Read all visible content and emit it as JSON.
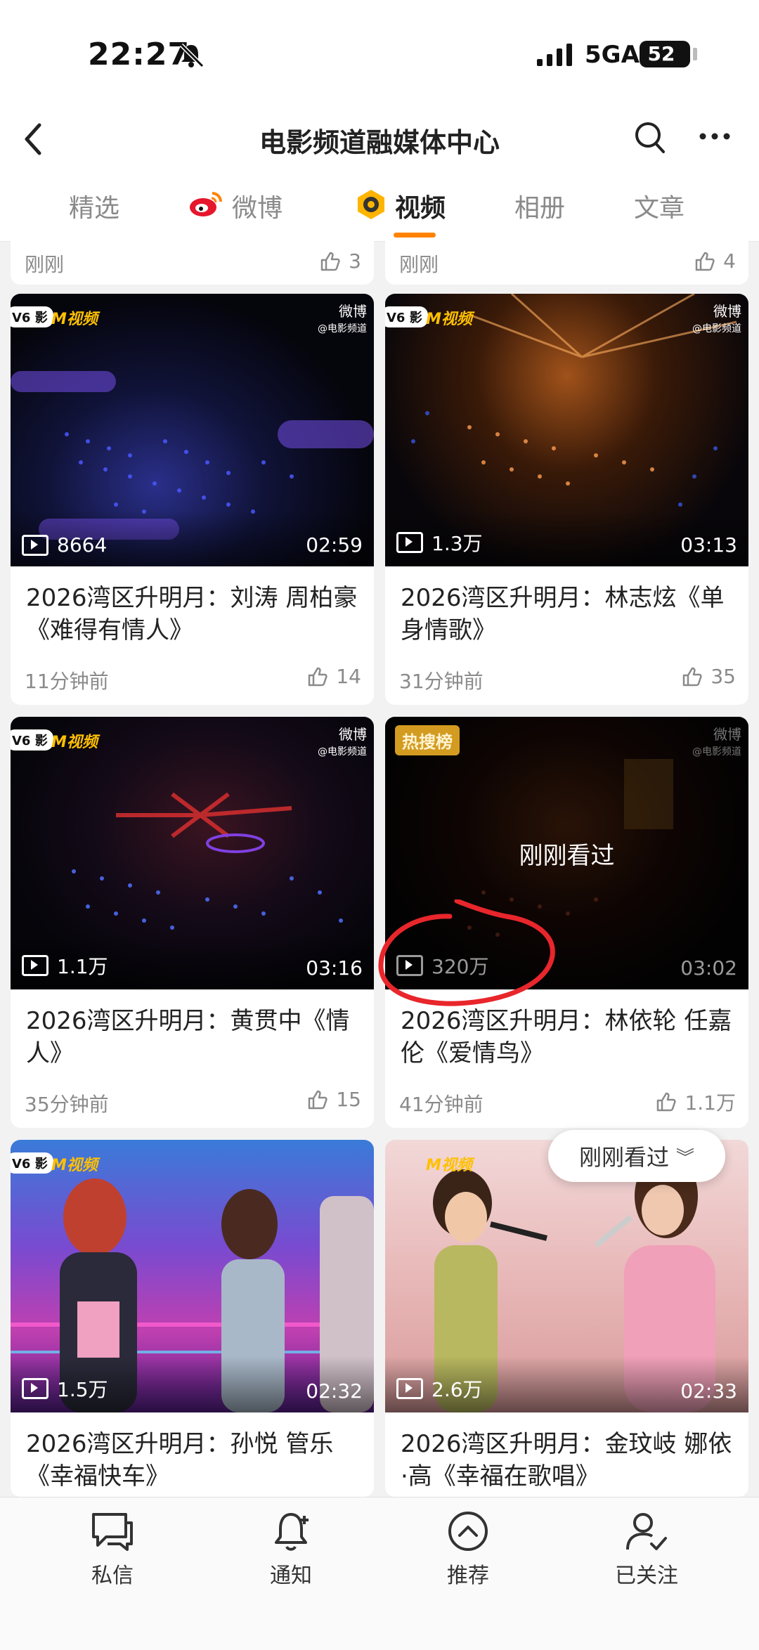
{
  "status_bar": {
    "time": "22:27",
    "network": "5GA",
    "battery": "52"
  },
  "header": {
    "title": "电影频道融媒体中心"
  },
  "tabs": [
    {
      "label": "精选",
      "active": false
    },
    {
      "label": "微博",
      "active": false
    },
    {
      "label": "视频",
      "active": true
    },
    {
      "label": "相册",
      "active": false
    },
    {
      "label": "文章",
      "active": false
    }
  ],
  "partial_cards": [
    {
      "time": "刚刚",
      "likes": "3"
    },
    {
      "time": "刚刚",
      "likes": "4"
    }
  ],
  "cards": [
    {
      "views": "8664",
      "duration": "02:59",
      "title": "2026湾区升明月：刘涛 周柏豪《难得有情人》",
      "time": "11分钟前",
      "likes": "14"
    },
    {
      "views": "1.3万",
      "duration": "03:13",
      "title": "2026湾区升明月：林志炫《单身情歌》",
      "time": "31分钟前",
      "likes": "35"
    },
    {
      "views": "1.1万",
      "duration": "03:16",
      "title": "2026湾区升明月：黄贯中《情人》",
      "time": "35分钟前",
      "likes": "15"
    },
    {
      "views": "320万",
      "duration": "03:02",
      "title": "2026湾区升明月：林依轮 任嘉伦《爱情鸟》",
      "time": "41分钟前",
      "likes": "1.1万",
      "badge": "热搜榜",
      "overlay_text": "刚刚看过"
    },
    {
      "views": "1.5万",
      "duration": "02:32",
      "title": "2026湾区升明月：孙悦 管乐《幸福快车》"
    },
    {
      "views": "2.6万",
      "duration": "02:33",
      "title": "2026湾区升明月：金玟岐 娜依·高《幸福在歌唱》"
    }
  ],
  "thumb_logos": {
    "cctv": "V6 影",
    "m": "M视频",
    "weibo": "微博",
    "weibo_sub": "@电影频道"
  },
  "float_button": {
    "label": "刚刚看过"
  },
  "bottom_nav": [
    {
      "label": "私信",
      "icon": "message-icon"
    },
    {
      "label": "通知",
      "icon": "bell-plus-icon"
    },
    {
      "label": "推荐",
      "icon": "chevron-up-circle-icon"
    },
    {
      "label": "已关注",
      "icon": "user-check-icon"
    }
  ],
  "colors": {
    "accent": "#ff8200",
    "annotation_red": "#e8262b",
    "hot_badge": "#d39b20"
  }
}
